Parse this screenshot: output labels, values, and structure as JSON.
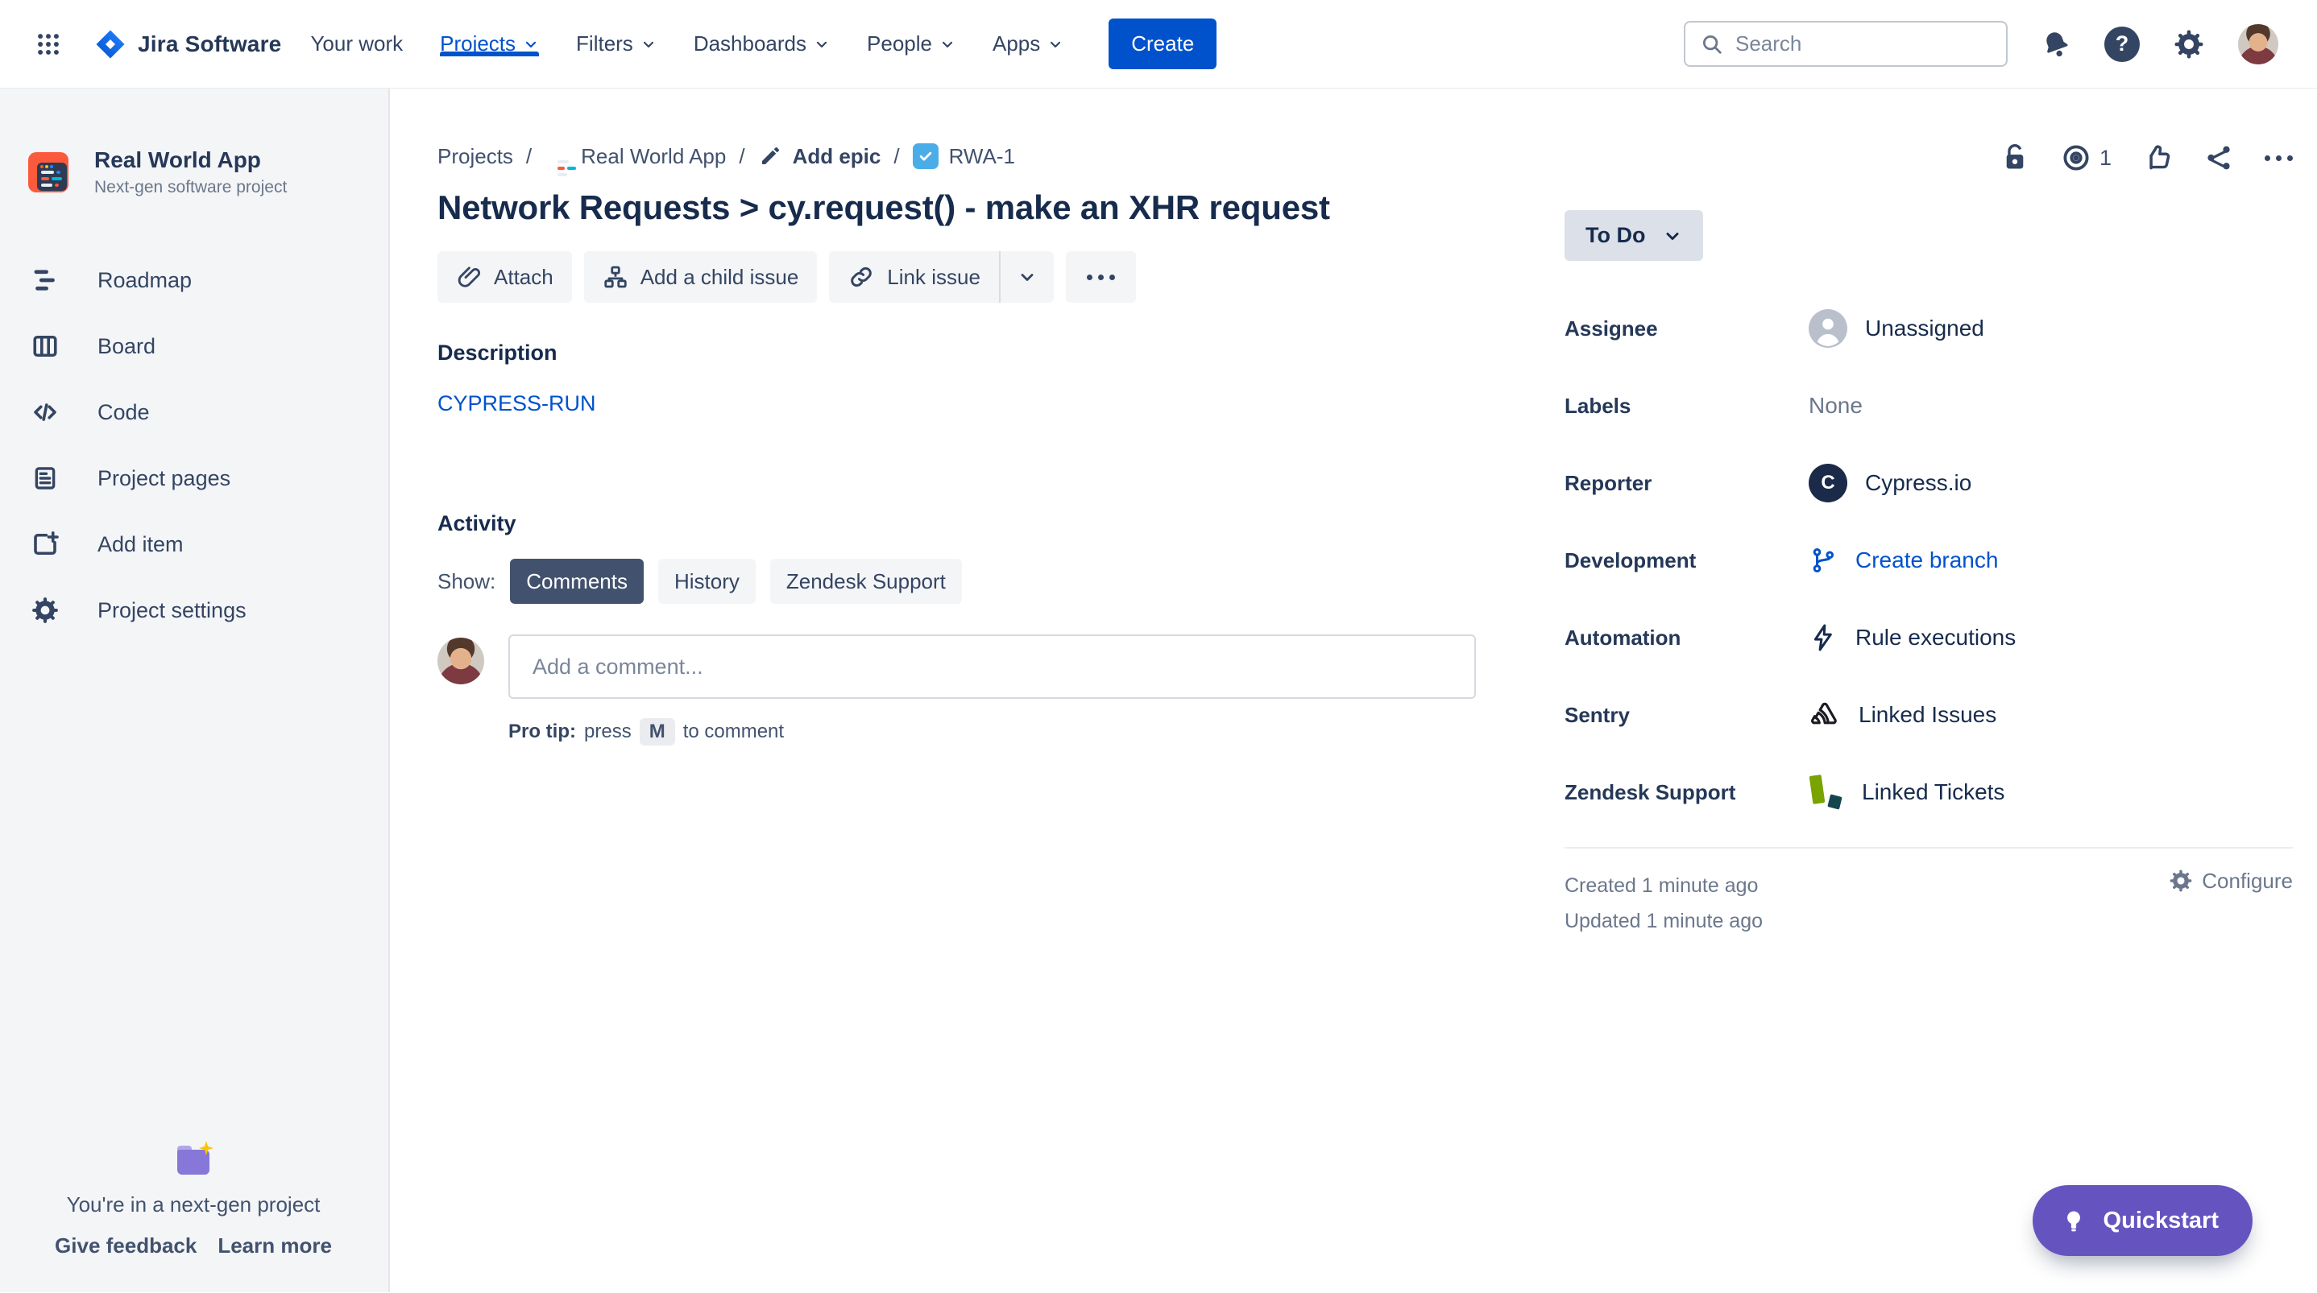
{
  "nav": {
    "logo_text": "Jira Software",
    "items": [
      {
        "label": "Your work"
      },
      {
        "label": "Projects"
      },
      {
        "label": "Filters"
      },
      {
        "label": "Dashboards"
      },
      {
        "label": "People"
      },
      {
        "label": "Apps"
      }
    ],
    "create_label": "Create",
    "search_placeholder": "Search",
    "help_glyph": "?"
  },
  "sidebar": {
    "project_name": "Real World App",
    "project_type": "Next-gen software project",
    "items": [
      {
        "label": "Roadmap"
      },
      {
        "label": "Board"
      },
      {
        "label": "Code"
      },
      {
        "label": "Project pages"
      },
      {
        "label": "Add item"
      },
      {
        "label": "Project settings"
      }
    ],
    "footer": {
      "message": "You're in a next-gen project",
      "give_feedback": "Give feedback",
      "learn_more": "Learn more"
    }
  },
  "breadcrumb": {
    "projects": "Projects",
    "separator": "/",
    "project": "Real World App",
    "add_epic": "Add epic",
    "issue_key": "RWA-1"
  },
  "issue": {
    "title": "Network Requests > cy.request() - make an XHR request",
    "toolbar": {
      "attach": "Attach",
      "add_child": "Add a child issue",
      "link": "Link issue"
    },
    "watch_count": "1",
    "status": {
      "label": "To Do"
    },
    "description": {
      "heading": "Description",
      "link_text": "CYPRESS-RUN"
    },
    "activity": {
      "heading": "Activity",
      "show_label": "Show:",
      "tabs": [
        {
          "label": "Comments"
        },
        {
          "label": "History"
        },
        {
          "label": "Zendesk Support"
        }
      ],
      "comment_placeholder": "Add a comment...",
      "pro_tip_prefix": "Pro tip:",
      "pro_tip_press": "press",
      "pro_tip_key": "M",
      "pro_tip_suffix": "to comment"
    },
    "fields": [
      {
        "label": "Assignee",
        "value": "Unassigned"
      },
      {
        "label": "Labels",
        "value": "None"
      },
      {
        "label": "Reporter",
        "value": "Cypress.io",
        "avatar_letter": "C"
      },
      {
        "label": "Development",
        "value": "Create branch"
      },
      {
        "label": "Automation",
        "value": "Rule executions"
      },
      {
        "label": "Sentry",
        "value": "Linked Issues"
      },
      {
        "label": "Zendesk Support",
        "value": "Linked Tickets"
      }
    ],
    "meta": {
      "created": "Created 1 minute ago",
      "updated": "Updated 1 minute ago",
      "configure": "Configure"
    }
  },
  "quickstart": {
    "label": "Quickstart"
  },
  "colors": {
    "accent_blue": "#0052CC",
    "nav_icon": "#344563",
    "heading_text": "#172B4D",
    "quickstart_purple": "#6554C0",
    "sidebar_bg": "#F4F5F7",
    "status_bg": "#DCE0E8",
    "project_avatar_orange": "#FC5A3C",
    "breadcrumb_check_blue": "#4BADE8",
    "zendesk_green": "#78A300"
  }
}
